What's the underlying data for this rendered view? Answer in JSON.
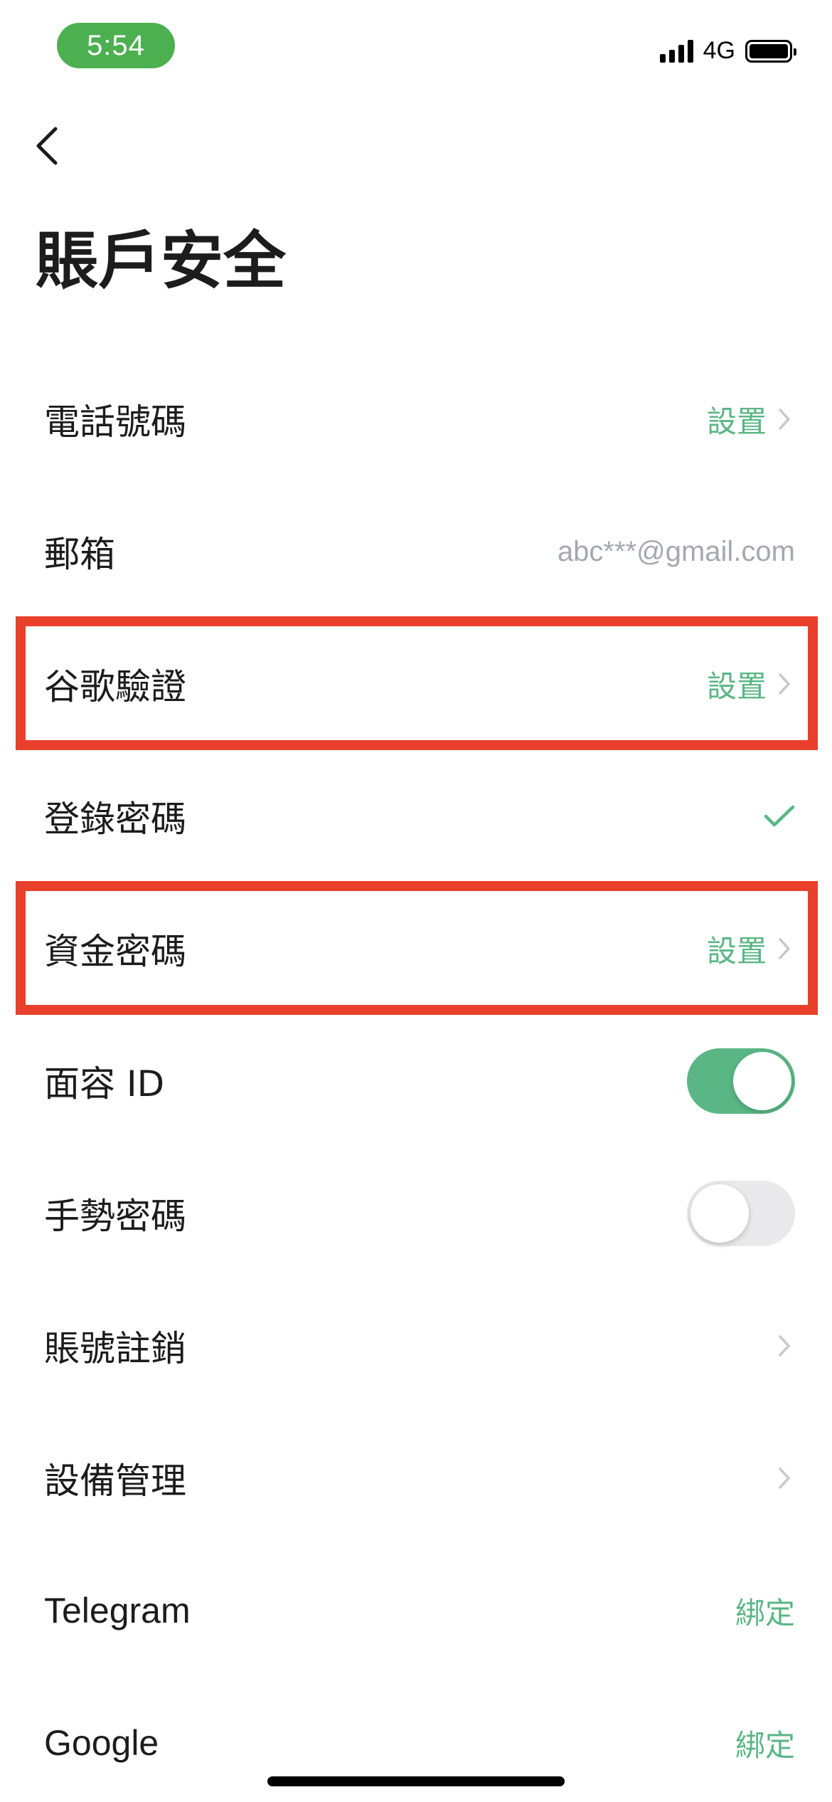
{
  "status_bar": {
    "time": "5:54",
    "network": "4G",
    "icons": [
      "signal-bars-icon",
      "battery-icon"
    ]
  },
  "header": {
    "back_icon": "chevron-left-icon",
    "title": "賬戶安全"
  },
  "rows": [
    {
      "label": "電話號碼",
      "right_type": "action",
      "right_text": "設置",
      "chevron": true
    },
    {
      "label": "郵箱",
      "right_type": "value",
      "right_text": "abc***@gmail.com",
      "chevron": false
    },
    {
      "label": "谷歌驗證",
      "right_type": "action",
      "right_text": "設置",
      "chevron": true,
      "highlighted": true
    },
    {
      "label": "登錄密碼",
      "right_type": "check",
      "right_icon": "checkmark-icon"
    },
    {
      "label": "資金密碼",
      "right_type": "action",
      "right_text": "設置",
      "chevron": true,
      "highlighted": true
    },
    {
      "label": "面容 ID",
      "right_type": "toggle",
      "toggle_on": true
    },
    {
      "label": "手勢密碼",
      "right_type": "toggle",
      "toggle_on": false
    },
    {
      "label": "賬號註銷",
      "right_type": "chevron",
      "chevron": true
    },
    {
      "label": "設備管理",
      "right_type": "chevron",
      "chevron": true
    },
    {
      "label": "Telegram",
      "right_type": "action",
      "right_text": "綁定",
      "chevron": false
    },
    {
      "label": "Google",
      "right_type": "action",
      "right_text": "綁定",
      "chevron": false
    }
  ],
  "colors": {
    "accent_green": "#5ab685",
    "status_time_bg": "#4caf50",
    "highlight_red": "#e8402a",
    "muted_text": "#a4a8b0",
    "chevron_grey": "#c7c7cc"
  }
}
